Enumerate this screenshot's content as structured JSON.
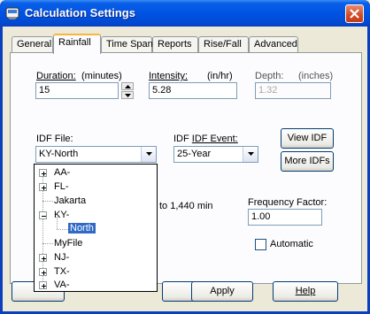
{
  "window": {
    "title": "Calculation Settings",
    "close_label": "×"
  },
  "tabs": [
    {
      "label": "General",
      "active": false
    },
    {
      "label": "Rainfall",
      "active": true
    },
    {
      "label": "Time Span",
      "active": false
    },
    {
      "label": "Reports",
      "active": false
    },
    {
      "label": "Rise/Fall",
      "active": false
    },
    {
      "label": "Advanced",
      "active": false
    }
  ],
  "rainfall": {
    "duration": {
      "label": "Duration:",
      "units": "(minutes)",
      "value": "15"
    },
    "intensity": {
      "label": "Intensity:",
      "units": "(in/hr)",
      "value": "5.28"
    },
    "depth": {
      "label": "Depth:",
      "units": "(inches)",
      "value": "1.32"
    },
    "idf_file": {
      "label": "IDF File:",
      "value": "KY-North"
    },
    "idf_event": {
      "label": "IDF Event:",
      "value": "25-Year"
    },
    "view_idf_label": "View IDF",
    "more_idfs_label": "More IDFs",
    "range_partial": "to 1,440 min",
    "frequency_factor": {
      "label": "Frequency Factor:",
      "value": "1.00"
    },
    "automatic": {
      "label": "Automatic",
      "checked": false
    }
  },
  "tree": [
    {
      "label": "AA-",
      "expander": "+"
    },
    {
      "label": "FL-",
      "expander": "+"
    },
    {
      "label": "Jakarta",
      "expander": ""
    },
    {
      "label": "KY-",
      "expander": "-"
    },
    {
      "label": "North",
      "expander": "",
      "selected": true
    },
    {
      "label": "MyFile",
      "expander": ""
    },
    {
      "label": "NJ-",
      "expander": "+"
    },
    {
      "label": "TX-",
      "expander": "+"
    },
    {
      "label": "VA-",
      "expander": "+"
    }
  ],
  "footer": {
    "apply_label": "Apply",
    "help_label": "Help"
  },
  "colors": {
    "titlebar": "#0054e3",
    "selection": "#316ac5",
    "tab_highlight": "#f3b83d"
  }
}
